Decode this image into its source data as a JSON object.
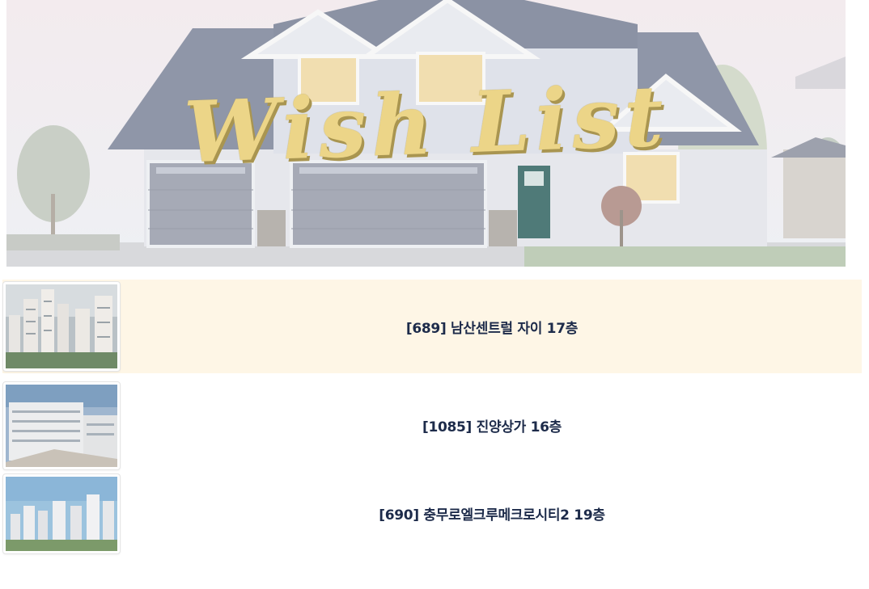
{
  "banner": {
    "title": "Wish List"
  },
  "wishlist": {
    "items": [
      {
        "label": "[689] 남산센트럴 자이 17층",
        "highlighted": true
      },
      {
        "label": "[1085] 진양상가 16층",
        "highlighted": false
      },
      {
        "label": "[690] 충무로엘크루메크로시티2 19층",
        "highlighted": false
      }
    ]
  },
  "colors": {
    "title_gold": "#ecd588",
    "highlight_row": "#fef6e6",
    "label_text": "#1d2b4a"
  }
}
